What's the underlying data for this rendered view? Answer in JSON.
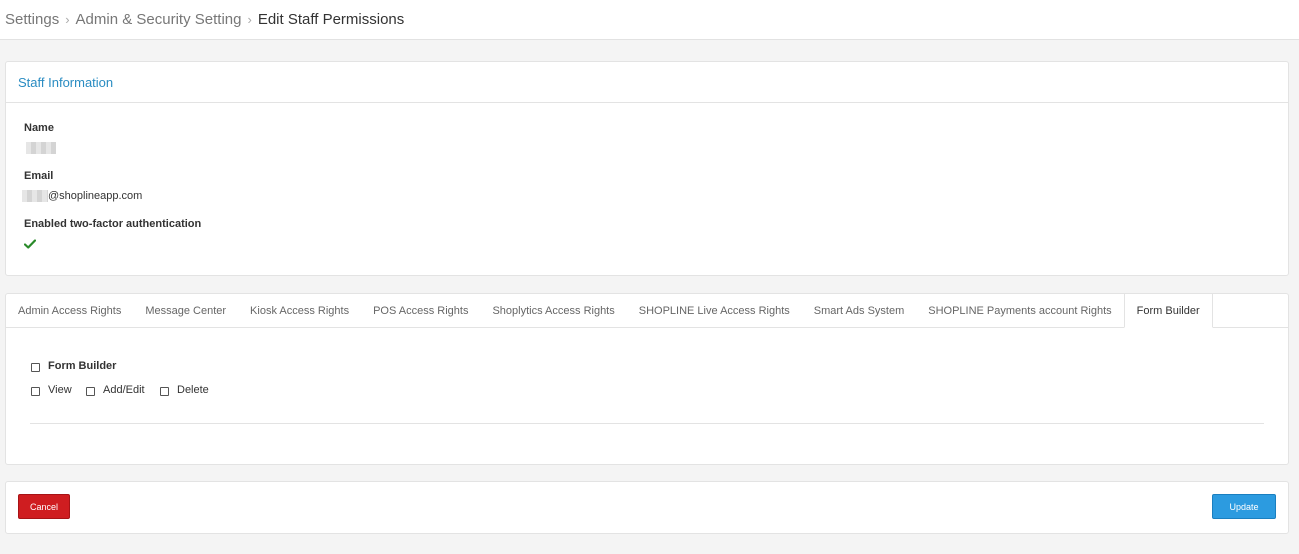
{
  "breadcrumb": {
    "items": [
      "Settings",
      "Admin & Security Setting",
      "Edit Staff Permissions"
    ],
    "separator": "›"
  },
  "staff_info": {
    "title": "Staff Information",
    "name_label": "Name",
    "email_label": "Email",
    "email_value": "@shoplineapp.com",
    "two_factor_label": "Enabled two-factor authentication",
    "two_factor_enabled": true,
    "check_color": "#2a8a2a"
  },
  "tabs": [
    {
      "label": "Admin Access Rights",
      "active": false
    },
    {
      "label": "Message Center",
      "active": false
    },
    {
      "label": "Kiosk Access Rights",
      "active": false
    },
    {
      "label": "POS Access Rights",
      "active": false
    },
    {
      "label": "Shoplytics Access Rights",
      "active": false
    },
    {
      "label": "SHOPLINE Live Access Rights",
      "active": false
    },
    {
      "label": "Smart Ads System",
      "active": false
    },
    {
      "label": "SHOPLINE Payments account Rights",
      "active": false
    },
    {
      "label": "Form Builder",
      "active": true
    }
  ],
  "form_builder": {
    "group_label": "Form Builder",
    "permissions": {
      "view": "View",
      "add_edit": "Add/Edit",
      "delete": "Delete"
    }
  },
  "actions": {
    "cancel_label": "Cancel",
    "update_label": "Update",
    "cancel_color": "#cf1d20",
    "update_color": "#2c9be0"
  }
}
